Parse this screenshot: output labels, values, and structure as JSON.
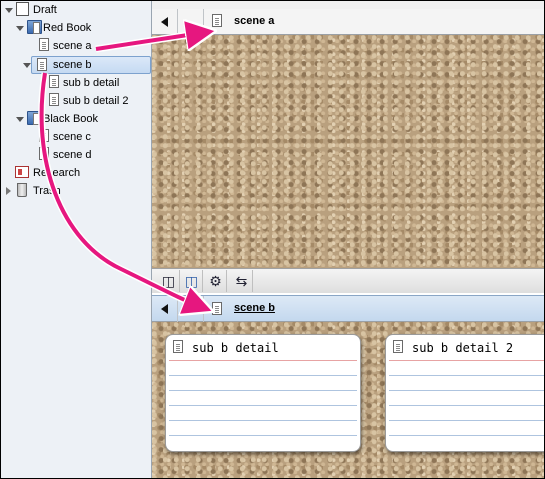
{
  "binder": {
    "items": [
      {
        "label": "Draft",
        "icon": "draft-icon"
      },
      {
        "label": "Red Book",
        "icon": "folder-icon"
      },
      {
        "label": "scene a",
        "icon": "document-icon"
      },
      {
        "label": "scene b",
        "icon": "document-stack-icon",
        "selected": true
      },
      {
        "label": "sub b detail",
        "icon": "document-icon"
      },
      {
        "label": "sub b detail 2",
        "icon": "document-icon"
      },
      {
        "label": "Black Book",
        "icon": "folder-icon"
      },
      {
        "label": "scene c",
        "icon": "document-icon"
      },
      {
        "label": "scene d",
        "icon": "document-icon"
      },
      {
        "label": "Research",
        "icon": "research-icon"
      },
      {
        "label": "Trash",
        "icon": "trash-icon"
      }
    ]
  },
  "top_pane": {
    "title": "scene a"
  },
  "bottom_pane": {
    "title": "scene b"
  },
  "footer": {
    "buttons": [
      "add-card-icon",
      "add-child-card-icon",
      "gear-icon",
      "swap-arrows-icon"
    ]
  },
  "cards": [
    {
      "title": "sub b detail"
    },
    {
      "title": "sub b detail 2"
    }
  ],
  "colors": {
    "annotation_arrow": "#e6177f",
    "header_active": "#cfe0f2",
    "binder_background": "#edf1f6",
    "cork": "#b9a07e"
  }
}
